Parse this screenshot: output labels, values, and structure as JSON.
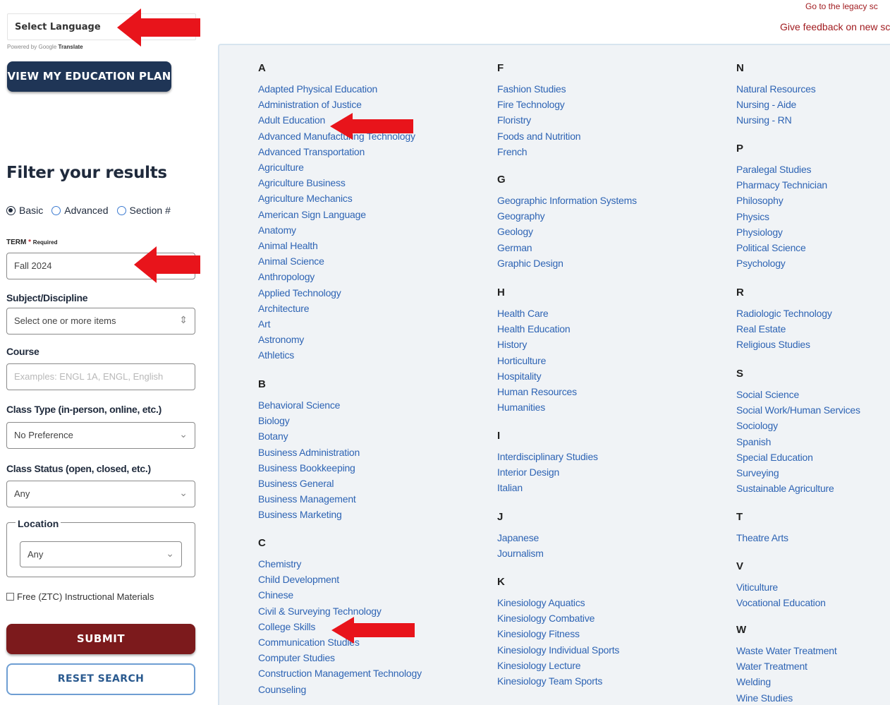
{
  "top": {
    "language_select": "Select Language",
    "powered_by": "Powered by Google",
    "translate": "Translate",
    "legacy_link": "Go to the legacy sc",
    "feedback_link": "Give feedback on new sc"
  },
  "sidebar": {
    "plan_button": "VIEW MY EDUCATION PLAN",
    "filter_title": "Filter your results",
    "search_modes": [
      "Basic",
      "Advanced",
      "Section #"
    ],
    "term_label": "TERM",
    "term_required": "Required",
    "term_value": "Fall 2024",
    "subject_label": "Subject/Discipline",
    "subject_value": "Select one or more items",
    "course_label": "Course",
    "course_placeholder": "Examples: ENGL 1A, ENGL, English",
    "class_type_label": "Class Type (in-person, online, etc.)",
    "class_type_value": "No Preference",
    "class_status_label": "Class Status (open, closed, etc.)",
    "class_status_value": "Any",
    "location_label": "Location",
    "location_value": "Any",
    "ztc_label": "Free (ZTC) Instructional Materials",
    "submit_button": "SUBMIT",
    "reset_button": "RESET SEARCH"
  },
  "subjects": {
    "A": [
      "Adapted Physical Education",
      "Administration of Justice",
      "Adult Education",
      "Advanced Manufacturing Technology",
      "Advanced Transportation",
      "Agriculture",
      "Agriculture Business",
      "Agriculture Mechanics",
      "American Sign Language",
      "Anatomy",
      "Animal Health",
      "Animal Science",
      "Anthropology",
      "Applied Technology",
      "Architecture",
      "Art",
      "Astronomy",
      "Athletics"
    ],
    "B": [
      "Behavioral Science",
      "Biology",
      "Botany",
      "Business Administration",
      "Business Bookkeeping",
      "Business General",
      "Business Management",
      "Business Marketing"
    ],
    "C": [
      "Chemistry",
      "Child Development",
      "Chinese",
      "Civil & Surveying Technology",
      "College Skills",
      "Communication Studies",
      "Computer Studies",
      "Construction Management Technology",
      "Counseling"
    ],
    "F": [
      "Fashion Studies",
      "Fire Technology",
      "Floristry",
      "Foods and Nutrition",
      "French"
    ],
    "G": [
      "Geographic Information Systems",
      "Geography",
      "Geology",
      "German",
      "Graphic Design"
    ],
    "H": [
      "Health Care",
      "Health Education",
      "History",
      "Horticulture",
      "Hospitality",
      "Human Resources",
      "Humanities"
    ],
    "I": [
      "Interdisciplinary Studies",
      "Interior Design",
      "Italian"
    ],
    "J": [
      "Japanese",
      "Journalism"
    ],
    "K": [
      "Kinesiology Aquatics",
      "Kinesiology Combative",
      "Kinesiology Fitness",
      "Kinesiology Individual Sports",
      "Kinesiology Lecture",
      "Kinesiology Team Sports"
    ],
    "N": [
      "Natural Resources",
      "Nursing - Aide",
      "Nursing - RN"
    ],
    "P": [
      "Paralegal Studies",
      "Pharmacy Technician",
      "Philosophy",
      "Physics",
      "Physiology",
      "Political Science",
      "Psychology"
    ],
    "R": [
      "Radiologic Technology",
      "Real Estate",
      "Religious Studies"
    ],
    "S": [
      "Social Science",
      "Social Work/Human Services",
      "Sociology",
      "Spanish",
      "Special Education",
      "Surveying",
      "Sustainable Agriculture"
    ],
    "T": [
      "Theatre Arts"
    ],
    "V": [
      "Viticulture",
      "Vocational Education"
    ],
    "W": [
      "Waste Water Treatment",
      "Water Treatment",
      "Welding",
      "Wine Studies"
    ]
  },
  "colors": {
    "navy": "#1f3556",
    "maroon": "#7c1a1c",
    "link": "#2e64b4",
    "arrow": "#e8141b"
  }
}
